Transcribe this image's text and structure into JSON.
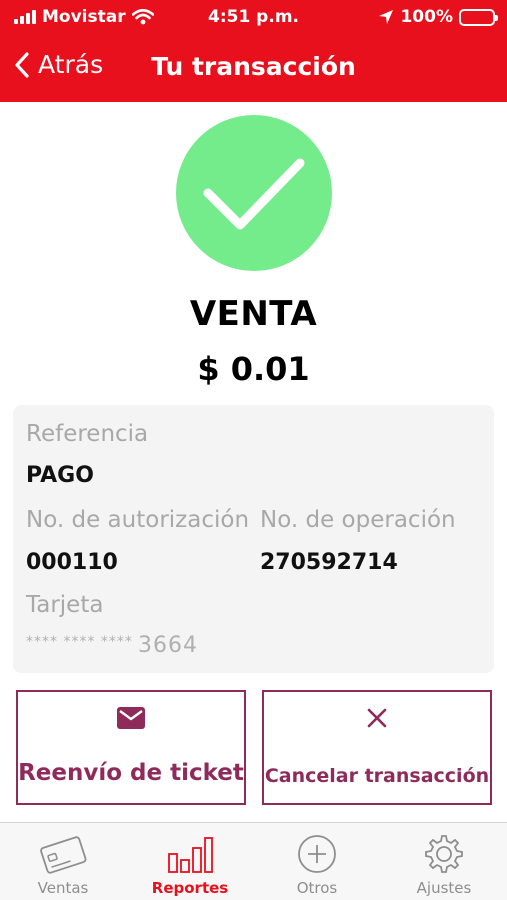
{
  "status_bar": {
    "carrier": "Movistar",
    "time": "4:51 p.m.",
    "battery": "100%",
    "icons": [
      "signal-icon",
      "wifi-icon",
      "location-arrow-icon",
      "battery-icon"
    ]
  },
  "header": {
    "back_label": "Atrás",
    "title": "Tu transacción",
    "background_color": "#e8101c"
  },
  "transaction": {
    "status_icon": "check-icon",
    "status_color": "#74ec8c",
    "type": "VENTA",
    "amount": "$ 0.01"
  },
  "details": {
    "reference_label": "Referencia",
    "reference_value": "PAGO",
    "authorization_label": "No. de autorización",
    "authorization_value": "000110",
    "operation_label": "No. de operación",
    "operation_value": "270592714",
    "card_label": "Tarjeta",
    "card_mask": "**** **** ****",
    "card_last4": "3664"
  },
  "actions": {
    "resend_label": "Reenvío de ticket",
    "resend_icon": "mail-icon",
    "cancel_label": "Cancelar transacción",
    "cancel_icon": "close-icon",
    "accent_color": "#8f2b5a"
  },
  "tabbar": {
    "active_color": "#e8101c",
    "items": [
      {
        "label": "Ventas",
        "icon": "card-icon",
        "active": false
      },
      {
        "label": "Reportes",
        "icon": "bar-chart-icon",
        "active": true
      },
      {
        "label": "Otros",
        "icon": "plus-circle-icon",
        "active": false
      },
      {
        "label": "Ajustes",
        "icon": "gear-icon",
        "active": false
      }
    ]
  }
}
